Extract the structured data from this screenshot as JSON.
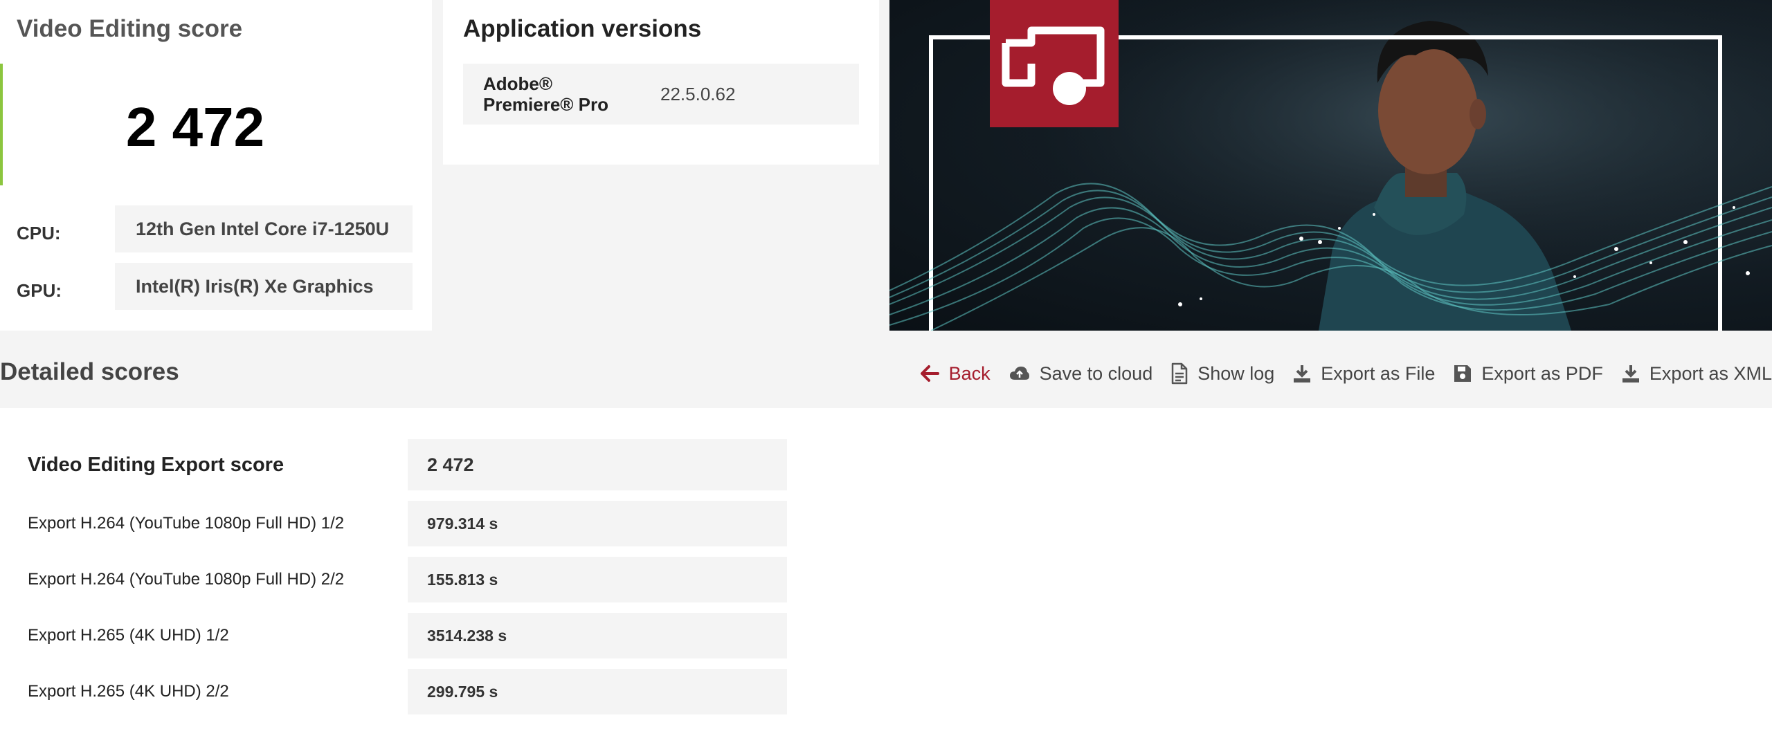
{
  "score_card": {
    "title": "Video Editing score",
    "score": "2 472",
    "cpu_label": "CPU:",
    "cpu_value": "12th Gen Intel Core i7-1250U",
    "gpu_label": "GPU:",
    "gpu_value": "Intel(R) Iris(R) Xe Graphics",
    "accent_color": "#8cc63f"
  },
  "versions": {
    "title": "Application versions",
    "app_line1": "Adobe®",
    "app_line2": "Premiere® Pro",
    "version": "22.5.0.62"
  },
  "hero": {
    "badge_color": "#a51d2d",
    "badge_icon": "video-projector-icon"
  },
  "detailed": {
    "title": "Detailed scores",
    "toolbar": {
      "back": "Back",
      "save_cloud": "Save to cloud",
      "show_log": "Show log",
      "export_file": "Export as File",
      "export_pdf": "Export as PDF",
      "export_xml": "Export as XML"
    },
    "rows": [
      {
        "label": "Video Editing Export score",
        "value": "2 472"
      },
      {
        "label": "Export H.264 (YouTube 1080p Full HD) 1/2",
        "value": "979.314 s"
      },
      {
        "label": "Export H.264 (YouTube 1080p Full HD) 2/2",
        "value": "155.813 s"
      },
      {
        "label": "Export H.265 (4K UHD) 1/2",
        "value": "3514.238 s"
      },
      {
        "label": "Export H.265 (4K UHD) 2/2",
        "value": "299.795 s"
      }
    ]
  },
  "colors": {
    "accent_red": "#a51d2d",
    "panel_gray": "#f4f4f4"
  }
}
